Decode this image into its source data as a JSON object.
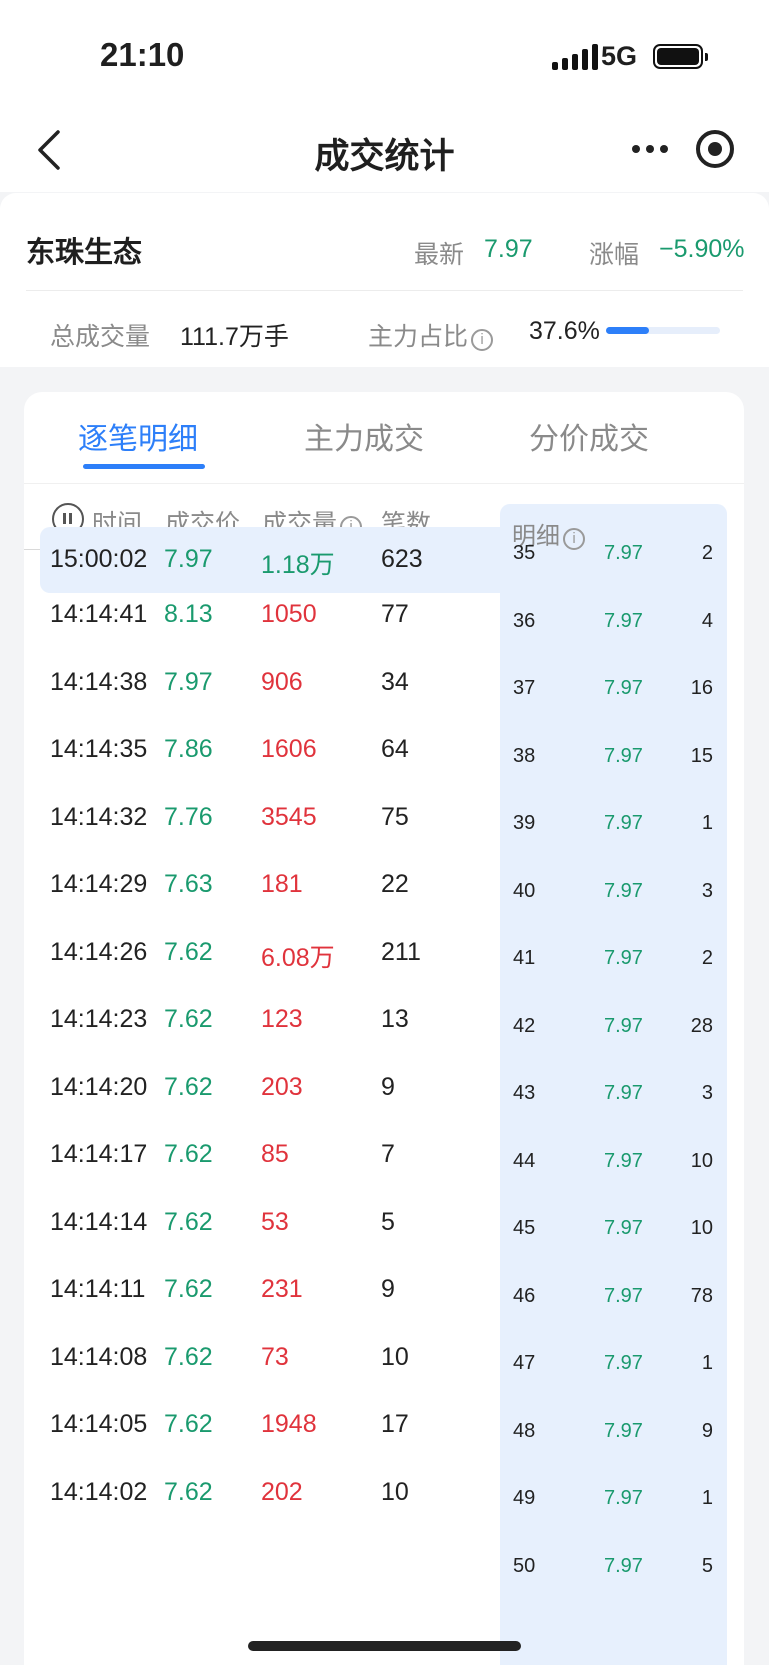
{
  "status": {
    "time": "21:10",
    "network": "5G"
  },
  "nav": {
    "title": "成交统计"
  },
  "stock": {
    "name": "东珠生态",
    "latest_label": "最新",
    "latest_value": "7.97",
    "change_label": "涨幅",
    "change_value": "−5.90%",
    "volume_label": "总成交量",
    "volume_value": "111.7万手",
    "main_ratio_label": "主力占比",
    "main_ratio_value": "37.6%",
    "main_ratio_fraction": 0.376
  },
  "tabs": [
    "逐笔明细",
    "主力成交",
    "分价成交"
  ],
  "table": {
    "headers": {
      "time": "时间",
      "price": "成交价",
      "volume": "成交量",
      "count": "笔数"
    },
    "rows": [
      {
        "time": "15:00:02",
        "price": "7.97",
        "volume": "1.18万",
        "count": "623"
      },
      {
        "time": "14:14:41",
        "price": "8.13",
        "volume": "1050",
        "count": "77"
      },
      {
        "time": "14:14:38",
        "price": "7.97",
        "volume": "906",
        "count": "34"
      },
      {
        "time": "14:14:35",
        "price": "7.86",
        "volume": "1606",
        "count": "64"
      },
      {
        "time": "14:14:32",
        "price": "7.76",
        "volume": "3545",
        "count": "75"
      },
      {
        "time": "14:14:29",
        "price": "7.63",
        "volume": "181",
        "count": "22"
      },
      {
        "time": "14:14:26",
        "price": "7.62",
        "volume": "6.08万",
        "count": "211"
      },
      {
        "time": "14:14:23",
        "price": "7.62",
        "volume": "123",
        "count": "13"
      },
      {
        "time": "14:14:20",
        "price": "7.62",
        "volume": "203",
        "count": "9"
      },
      {
        "time": "14:14:17",
        "price": "7.62",
        "volume": "85",
        "count": "7"
      },
      {
        "time": "14:14:14",
        "price": "7.62",
        "volume": "53",
        "count": "5"
      },
      {
        "time": "14:14:11",
        "price": "7.62",
        "volume": "231",
        "count": "9"
      },
      {
        "time": "14:14:08",
        "price": "7.62",
        "volume": "73",
        "count": "10"
      },
      {
        "time": "14:14:05",
        "price": "7.62",
        "volume": "1948",
        "count": "17"
      },
      {
        "time": "14:14:02",
        "price": "7.62",
        "volume": "202",
        "count": "10"
      }
    ]
  },
  "detail": {
    "header": "明细",
    "rows": [
      {
        "idx": "35",
        "price": "7.97",
        "count": "2"
      },
      {
        "idx": "36",
        "price": "7.97",
        "count": "4"
      },
      {
        "idx": "37",
        "price": "7.97",
        "count": "16"
      },
      {
        "idx": "38",
        "price": "7.97",
        "count": "15"
      },
      {
        "idx": "39",
        "price": "7.97",
        "count": "1"
      },
      {
        "idx": "40",
        "price": "7.97",
        "count": "3"
      },
      {
        "idx": "41",
        "price": "7.97",
        "count": "2"
      },
      {
        "idx": "42",
        "price": "7.97",
        "count": "28"
      },
      {
        "idx": "43",
        "price": "7.97",
        "count": "3"
      },
      {
        "idx": "44",
        "price": "7.97",
        "count": "10"
      },
      {
        "idx": "45",
        "price": "7.97",
        "count": "10"
      },
      {
        "idx": "46",
        "price": "7.97",
        "count": "78"
      },
      {
        "idx": "47",
        "price": "7.97",
        "count": "1"
      },
      {
        "idx": "48",
        "price": "7.97",
        "count": "9"
      },
      {
        "idx": "49",
        "price": "7.97",
        "count": "1"
      },
      {
        "idx": "50",
        "price": "7.97",
        "count": "5"
      }
    ]
  },
  "colors": {
    "up": "#e0333c",
    "down": "#1a9a6e",
    "accent": "#2d7ff9"
  }
}
